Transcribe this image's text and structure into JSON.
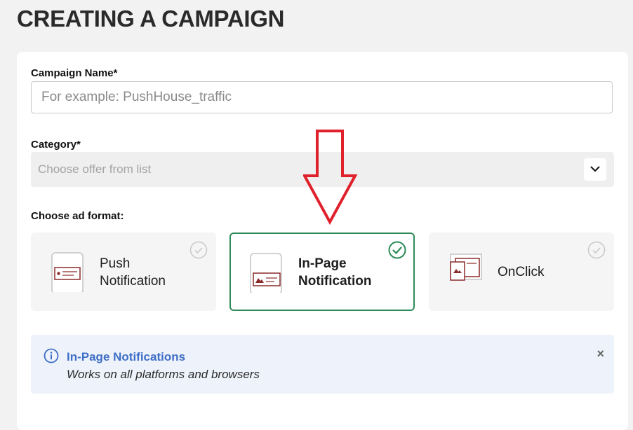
{
  "page": {
    "title": "CREATING A CAMPAIGN"
  },
  "form": {
    "campaign_name_label": "Campaign Name*",
    "campaign_name_placeholder": "For example: PushHouse_traffic",
    "campaign_name_value": "",
    "category_label": "Category*",
    "category_placeholder": "Choose offer from list",
    "ad_format_label": "Choose ad format:"
  },
  "formats": [
    {
      "line1": "Push",
      "line2": "Notification",
      "selected": false,
      "icon": "phone-push-icon"
    },
    {
      "line1": "In-Page",
      "line2": "Notification",
      "selected": true,
      "icon": "phone-inpage-icon"
    },
    {
      "line1": "OnClick",
      "selected": false,
      "icon": "browser-windows-icon"
    }
  ],
  "info": {
    "title": "In-Page Notifications",
    "text": "Works on all platforms and browsers",
    "close_symbol": "×"
  },
  "colors": {
    "accent_green": "#2e8b57",
    "info_blue": "#3f6ec6",
    "annotation_red": "#e0202a",
    "device_red": "#8b2a2a"
  }
}
